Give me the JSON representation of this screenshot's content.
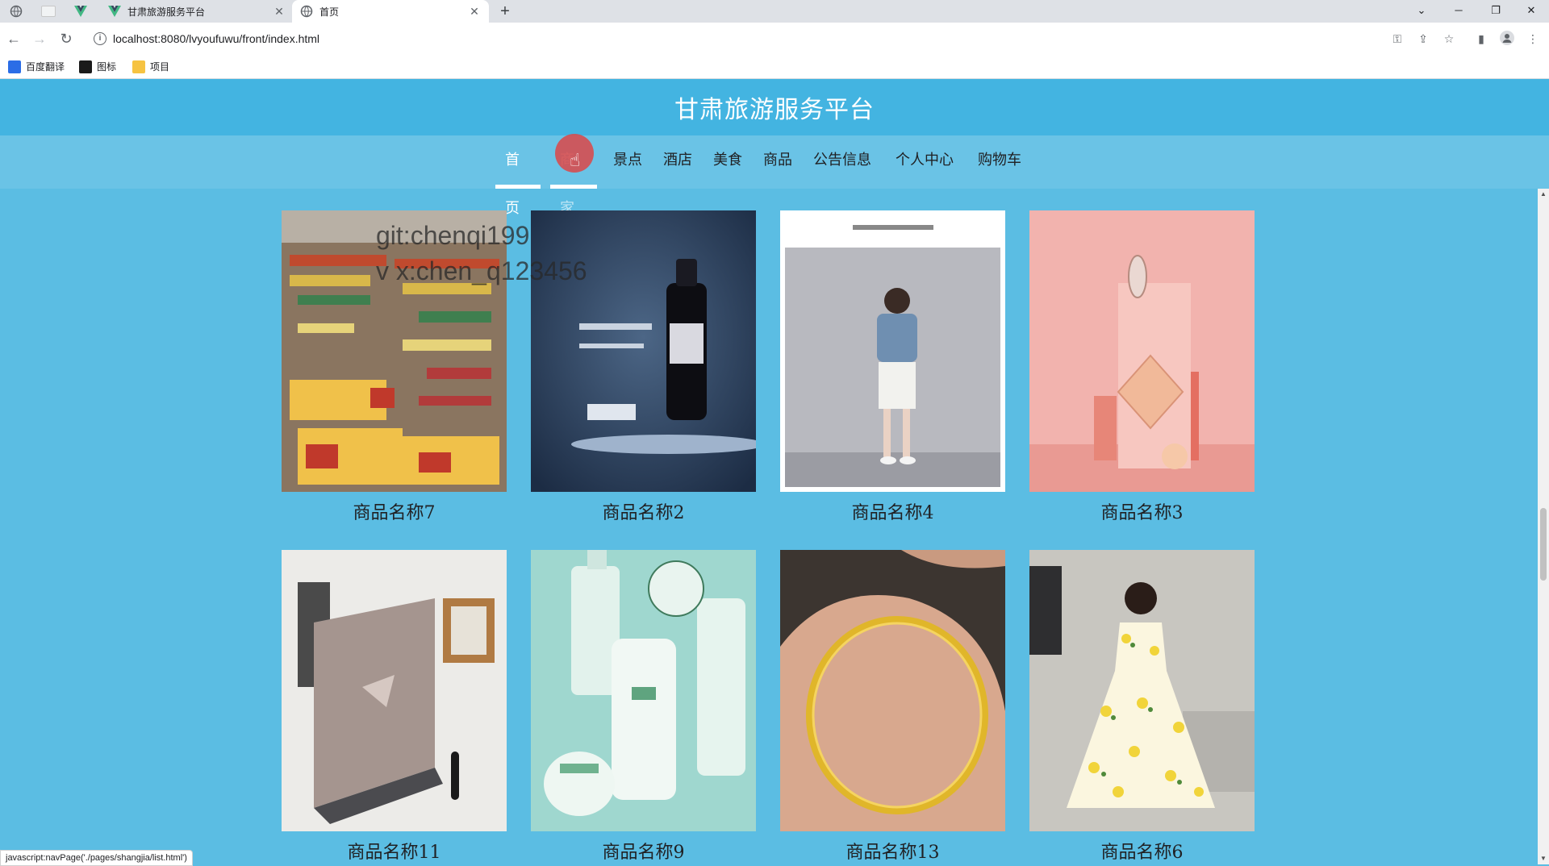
{
  "browser": {
    "tabs": [
      {
        "title": "甘肃旅游服务平台",
        "active": false
      },
      {
        "title": "首页",
        "active": true
      }
    ],
    "url": "localhost:8080/lvyoufuwu/front/index.html",
    "bookmarks": [
      "百度翻译",
      "图标",
      "项目"
    ],
    "status_url": "javascript:navPage('./pages/shangjia/list.html')"
  },
  "site": {
    "title": "甘肃旅游服务平台"
  },
  "nav": {
    "items": [
      {
        "label": "首页",
        "state": "active"
      },
      {
        "label": "商家",
        "state": "hovered"
      },
      {
        "label": "景点",
        "state": ""
      },
      {
        "label": "酒店",
        "state": ""
      },
      {
        "label": "美食",
        "state": ""
      },
      {
        "label": "商品",
        "state": ""
      },
      {
        "label": "公告信息",
        "state": ""
      },
      {
        "label": "个人中心",
        "state": ""
      },
      {
        "label": "购物车",
        "state": ""
      }
    ]
  },
  "watermark": {
    "line1": "git:chenqi199",
    "line2": "v x:chen_q123456"
  },
  "products": [
    {
      "name": "商品名称7",
      "image": "supermarket-shelves"
    },
    {
      "name": "商品名称2",
      "image": "lancome-serum"
    },
    {
      "name": "商品名称4",
      "image": "woman-outfit"
    },
    {
      "name": "商品名称3",
      "image": "cosmetics-pink"
    },
    {
      "name": "商品名称11",
      "image": "gaming-laptop"
    },
    {
      "name": "商品名称9",
      "image": "skincare-bottles"
    },
    {
      "name": "商品名称13",
      "image": "gold-bracelet"
    },
    {
      "name": "商品名称6",
      "image": "lemon-dress"
    }
  ],
  "colors": {
    "page_bg": "#5bbde3",
    "header_bg": "#43b4e1",
    "nav_bg": "#6ac3e6"
  }
}
